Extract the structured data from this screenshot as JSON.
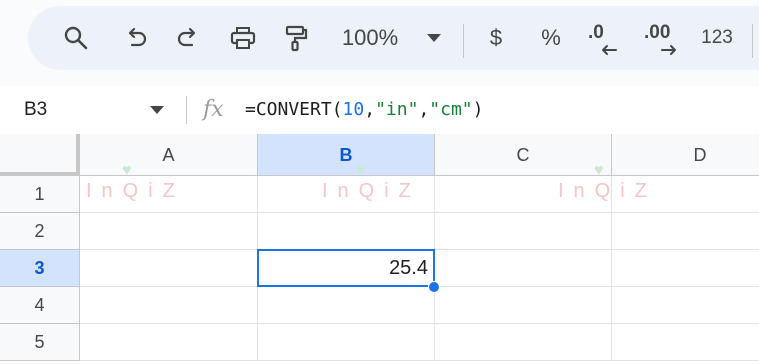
{
  "toolbar": {
    "zoom": "100%",
    "currency_symbol": "$",
    "percent_symbol": "%",
    "decrease_decimal": ".0",
    "increase_decimal": ".00",
    "more_formats": "123"
  },
  "formula_bar": {
    "cell_ref": "B3",
    "fx_label": "fx",
    "formula_parts": [
      "=CONVERT(",
      "10",
      ",",
      "\"in\"",
      ",",
      "\"cm\"",
      ")"
    ]
  },
  "grid": {
    "columns": [
      "A",
      "B",
      "C",
      "D"
    ],
    "rows": [
      "1",
      "2",
      "3",
      "4",
      "5"
    ],
    "selected_column": "B",
    "selected_row": "3",
    "cells": {
      "B3": "25.4"
    }
  },
  "watermark": {
    "text": "InQiZ"
  },
  "colors": {
    "accent": "#1a73e8",
    "header_selected": "#d3e3fd",
    "formula_number": "#1a73e8",
    "formula_string": "#188038"
  }
}
